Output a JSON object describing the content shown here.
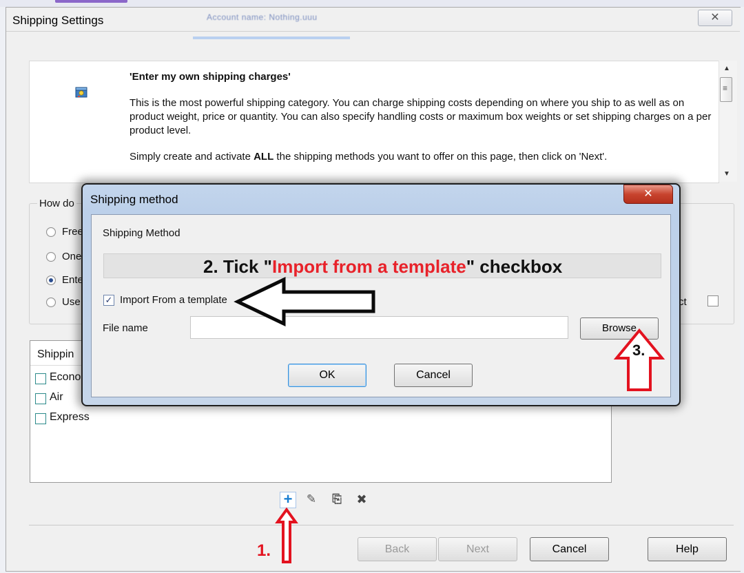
{
  "background": {
    "blurred_account": "Account name: Nothing.uuu"
  },
  "window": {
    "title": "Shipping Settings",
    "close_glyph": "✕"
  },
  "info": {
    "heading": "'Enter my own shipping charges'",
    "description": "This is the most powerful shipping category. You can charge shipping costs depending on where you ship to as well as on product weight, price or quantity. You can also specify handling costs or maximum box weights or set shipping charges on a per product level.",
    "instruction_pre": "Simply create and activate ",
    "instruction_bold": "ALL",
    "instruction_post": " the shipping methods you want to offer  on this page, then click on 'Next'.",
    "icon": "shipping-box-icon"
  },
  "group": {
    "legend": "How do",
    "options": [
      {
        "label": "Free",
        "checked": false
      },
      {
        "label": "One",
        "checked": false
      },
      {
        "label": "Ente",
        "checked": true
      },
      {
        "label": "Use",
        "checked": false
      }
    ],
    "per_product_label": "ct"
  },
  "shipping_list": {
    "header": "Shippin",
    "items": [
      "Econo",
      "Air",
      "Express"
    ]
  },
  "toolbar": {
    "add": "+",
    "edit": "✎",
    "import": "⎘",
    "delete": "✖"
  },
  "buttons": {
    "back": "Back",
    "next": "Next",
    "cancel": "Cancel",
    "help": "Help"
  },
  "dialog": {
    "title": "Shipping method",
    "close_glyph": "✕",
    "section_label": "Shipping Method",
    "banner_pre": "2. Tick \"",
    "banner_red": "Import from a template",
    "banner_post": "\" checkbox",
    "import_label": "Import From a template",
    "import_checked": true,
    "check_glyph": "✓",
    "file_label": "File name",
    "file_value": "",
    "browse": "Browse",
    "ok": "OK",
    "cancel": "Cancel"
  },
  "annotations": {
    "step1": "1.",
    "step3": "3."
  },
  "colors": {
    "annotation_red": "#e3121f",
    "dialog_frame": "#c3d5ec",
    "close_red": "#c8442e"
  }
}
